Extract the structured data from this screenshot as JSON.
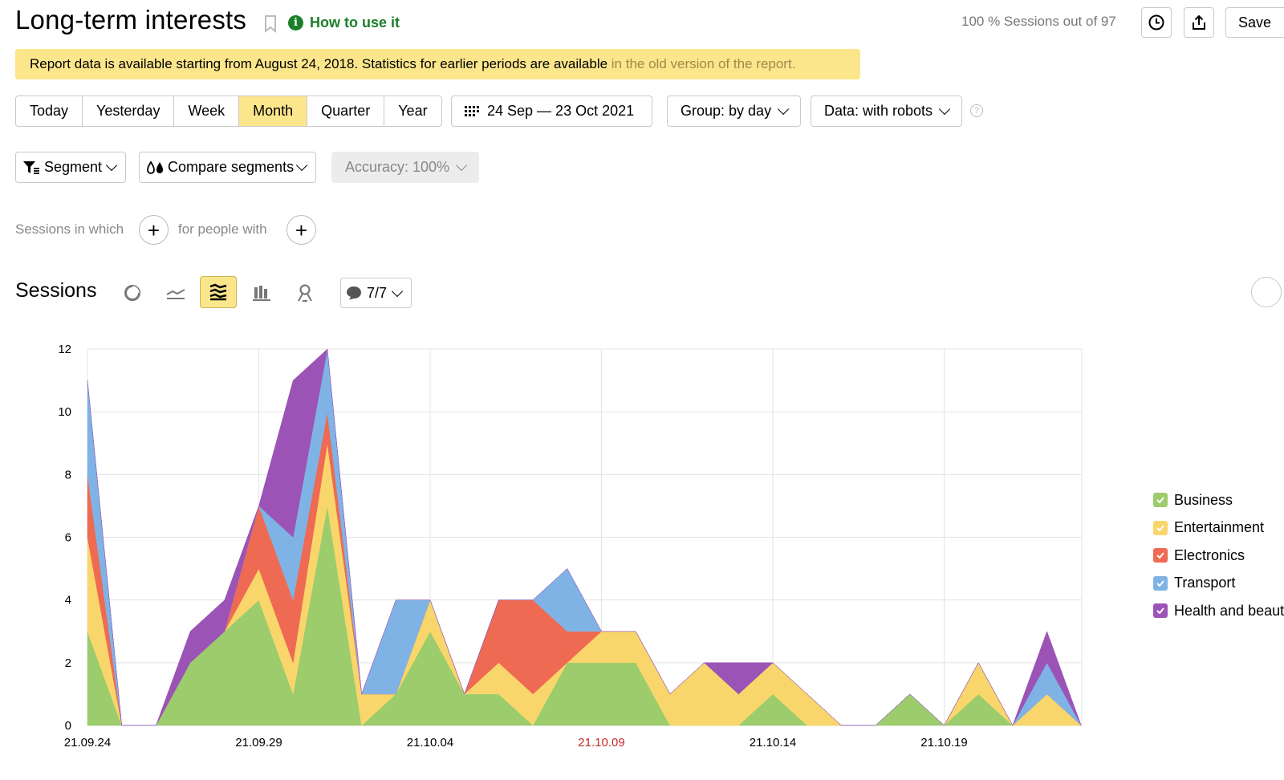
{
  "header": {
    "title": "Long-term interests",
    "how_to_use": "How to use it",
    "sessions_info": "100 % Sessions out of 97",
    "save_label": "Save"
  },
  "notice": {
    "text": "Report data is available starting from August 24, 2018. Statistics for earlier periods are available ",
    "link": "in the old version of the report."
  },
  "toolbar": {
    "periods": [
      "Today",
      "Yesterday",
      "Week",
      "Month",
      "Quarter",
      "Year"
    ],
    "active_period": "Month",
    "date_range": "24 Sep — 23 Oct 2021",
    "group_by": "Group: by day",
    "data_mode": "Data: with robots",
    "segment": "Segment",
    "compare_segments": "Compare segments",
    "accuracy": "Accuracy: 100%"
  },
  "filters": {
    "sessions_in_which": "Sessions in which",
    "for_people_with": "for people with"
  },
  "chart_section": {
    "title": "Sessions",
    "series_counter": "7/7",
    "active_view": "stacked-area"
  },
  "colors": {
    "accent_yellow": "#fbe68c",
    "link_green": "#1a7f2a",
    "weekend_date": "#c62828"
  },
  "chart_data": {
    "type": "area",
    "stacked": true,
    "ylim": [
      0,
      12
    ],
    "yticks": [
      0,
      2,
      4,
      6,
      8,
      10,
      12
    ],
    "x": [
      "21.09.24",
      "21.09.25",
      "21.09.26",
      "21.09.27",
      "21.09.28",
      "21.09.29",
      "21.09.30",
      "21.10.01",
      "21.10.02",
      "21.10.03",
      "21.10.04",
      "21.10.05",
      "21.10.06",
      "21.10.07",
      "21.10.08",
      "21.10.09",
      "21.10.10",
      "21.10.11",
      "21.10.12",
      "21.10.13",
      "21.10.14",
      "21.10.15",
      "21.10.16",
      "21.10.17",
      "21.10.18",
      "21.10.19",
      "21.10.20",
      "21.10.21",
      "21.10.22",
      "21.10.23"
    ],
    "xtick_labels": [
      "21.09.24",
      "21.09.29",
      "21.10.04",
      "21.10.09",
      "21.10.14",
      "21.10.19"
    ],
    "highlighted_tick": "21.10.09",
    "grid": true,
    "legend_position": "right",
    "series": [
      {
        "name": "Business",
        "color": "#9ccc6c",
        "values": [
          3,
          0,
          0,
          2,
          3,
          4,
          1,
          7,
          0,
          1,
          3,
          1,
          1,
          0,
          2,
          2,
          2,
          0,
          0,
          0,
          1,
          0,
          0,
          0,
          1,
          0,
          1,
          0,
          0,
          0
        ]
      },
      {
        "name": "Entertainment",
        "color": "#f9d66b",
        "values": [
          3,
          0,
          0,
          0,
          0,
          1,
          1,
          2,
          1,
          0,
          1,
          0,
          1,
          1,
          0,
          1,
          1,
          1,
          2,
          1,
          1,
          1,
          0,
          0,
          0,
          0,
          1,
          0,
          1,
          0
        ]
      },
      {
        "name": "Electronics",
        "color": "#ef6a52",
        "values": [
          2,
          0,
          0,
          0,
          0,
          2,
          2,
          1,
          0,
          0,
          0,
          0,
          2,
          3,
          1,
          0,
          0,
          0,
          0,
          0,
          0,
          0,
          0,
          0,
          0,
          0,
          0,
          0,
          0,
          0
        ]
      },
      {
        "name": "Transport",
        "color": "#7fb3e6",
        "values": [
          3,
          0,
          0,
          0,
          0,
          0,
          2,
          2,
          0,
          3,
          0,
          0,
          0,
          0,
          2,
          0,
          0,
          0,
          0,
          0,
          0,
          0,
          0,
          0,
          0,
          0,
          0,
          0,
          1,
          0
        ]
      },
      {
        "name": "Health and beauty",
        "color": "#9b54b5",
        "values": [
          0,
          0,
          0,
          1,
          1,
          0,
          5,
          0,
          0,
          0,
          0,
          0,
          0,
          0,
          0,
          0,
          0,
          0,
          0,
          1,
          0,
          0,
          0,
          0,
          0,
          0,
          0,
          0,
          1,
          0
        ]
      }
    ]
  }
}
